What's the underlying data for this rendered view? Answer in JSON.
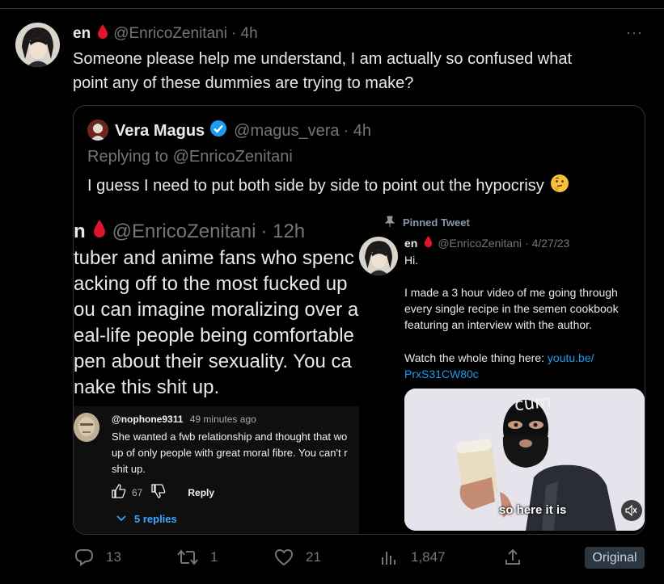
{
  "tweet": {
    "author_name": "en",
    "handle": "@EnricoZenitani",
    "time": "· 4h",
    "more": "···",
    "text_line1": "Someone please help me understand, I am actually so confused what",
    "text_line2": "point any of these dummies are trying to make?"
  },
  "quote": {
    "author_name": "Vera Magus",
    "handle": "@magus_vera",
    "time": "· 4h",
    "replying_to": "Replying to @EnricoZenitani",
    "text": "I guess I need to put both side by side to point out the hypocrisy",
    "emoji": "🤔"
  },
  "left_image": {
    "header_name": "n",
    "handle": "@EnricoZenitani",
    "time": "· 12h",
    "lines": [
      "tuber and anime fans who spenc",
      "acking off to the most fucked up",
      "ou can imagine moralizing over a",
      "eal-life people being comfortable",
      "pen about their sexuality. You ca",
      "nake this shit up."
    ],
    "comment": {
      "username": "@nophone9311",
      "time": "49 minutes ago",
      "lines": [
        "She wanted a fwb relationship and thought that wo",
        "up of only people with great moral fibre. You can't r",
        "shit up."
      ],
      "likes": "67",
      "reply_label": "Reply",
      "replies_label": "5 replies"
    }
  },
  "right_image": {
    "pinned_label": "Pinned Tweet",
    "author_name": "en",
    "handle": "@EnricoZenitani",
    "time": "· 4/27/23",
    "greeting": "Hi.",
    "body_lines": [
      "I made a 3 hour video of me going through",
      "every single recipe in the semen cookbook",
      "featuring an interview with the author."
    ],
    "watch_text": "Watch the whole thing here: ",
    "link_line1": "youtu.be/",
    "link_line2": "PrxS31CW80c",
    "video_caption": "so here it is",
    "mask_text": "cum"
  },
  "actions": {
    "replies": "13",
    "retweets": "1",
    "likes": "21",
    "views": "1,847",
    "original_label": "Original"
  },
  "colors": {
    "background": "#000000",
    "border": "#2f3336",
    "muted": "#71767b",
    "link": "#1d9bf0",
    "verified": "#1d9bf0",
    "blood_drop": "#e0142b"
  }
}
